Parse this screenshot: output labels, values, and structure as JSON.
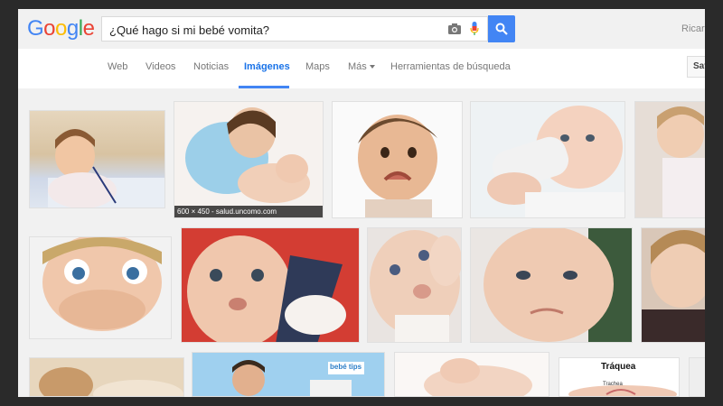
{
  "logo": "Google",
  "search": {
    "query": "¿Qué hago si mi bebé vomita?"
  },
  "user": {
    "name": "Ricard"
  },
  "nav": {
    "tabs": [
      {
        "label": "Web"
      },
      {
        "label": "Videos"
      },
      {
        "label": "Noticias"
      },
      {
        "label": "Imágenes"
      },
      {
        "label": "Maps"
      },
      {
        "label": "Más"
      },
      {
        "label": "Herramientas de búsqueda"
      }
    ],
    "active_tab": "Imágenes",
    "safesearch": "Saf"
  },
  "results": {
    "tooltip": "600 × 450 - salud.uncomo.com",
    "thumbnail_text_1": "Tráquea",
    "thumbnail_text_2": "Trachea",
    "thumbnail_text_3": "bebé tips"
  },
  "colors": {
    "accent": "#4285f4",
    "header_bg": "#f1f1f1"
  }
}
